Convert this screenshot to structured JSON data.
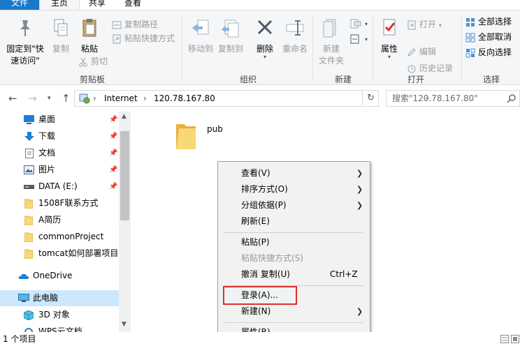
{
  "ribbon_tabs": {
    "file": "文件",
    "home": "主页",
    "share": "共享",
    "view": "查看"
  },
  "ribbon": {
    "clipboard": {
      "pin_line1": "固定到\"快",
      "pin_line2": "速访问\"",
      "copy": "复制",
      "paste": "粘贴",
      "copy_path": "复制路径",
      "paste_shortcut": "粘贴快捷方式",
      "cut": "剪切",
      "label": "剪贴板"
    },
    "organize": {
      "move_to": "移动到",
      "copy_to": "复制到",
      "delete": "删除",
      "rename": "重命名",
      "label": "组织"
    },
    "new": {
      "new_folder_line1": "新建",
      "new_folder_line2": "文件夹",
      "label": "新建"
    },
    "open": {
      "properties": "属性",
      "open": "打开",
      "edit": "编辑",
      "history": "历史记录",
      "label": "打开"
    },
    "select": {
      "select_all": "全部选择",
      "select_none": "全部取消",
      "invert": "反向选择",
      "label": "选择"
    }
  },
  "address": {
    "seg1": "Internet",
    "seg2": "120.78.167.80"
  },
  "search": {
    "placeholder": "搜索\"120.78.167.80\""
  },
  "nav": {
    "desktop": "桌面",
    "downloads": "下载",
    "documents": "文档",
    "pictures": "图片",
    "drive_e": "DATA (E:)",
    "folder1": "1508F联系方式",
    "folder2": "A简历",
    "folder3": "commonProject",
    "folder4": "tomcat如何部署项目,",
    "onedrive": "OneDrive",
    "thispc": "此电脑",
    "objects3d": "3D 对象",
    "wps": "WPS云文档"
  },
  "files": [
    {
      "name": "pub"
    }
  ],
  "context_menu": {
    "view": "查看(V)",
    "sort": "排序方式(O)",
    "group": "分组依据(P)",
    "refresh": "刷新(E)",
    "paste": "粘贴(P)",
    "paste_shortcut": "粘贴快捷方式(S)",
    "undo": "撤消 复制(U)",
    "undo_shortcut": "Ctrl+Z",
    "login": "登录(A)...",
    "new": "新建(N)",
    "properties": "属性(R)"
  },
  "status": {
    "count": "1 个项目"
  },
  "colors": {
    "accent": "#1979ca",
    "highlight_box": "#d9302c",
    "selected": "#cce8ff"
  }
}
